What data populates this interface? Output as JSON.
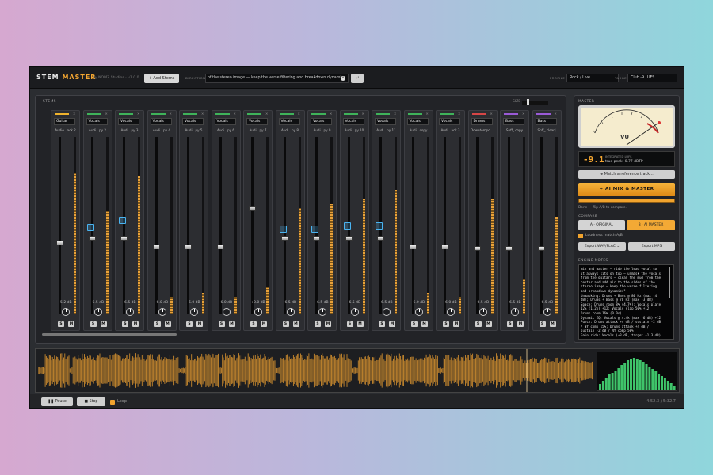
{
  "app": {
    "brand_a": "STEM",
    "brand_b": "MASTER",
    "subtitle": "by NOMZ Studios · v1.0.0",
    "add_stems": "+ Add Stems",
    "direction_label": "DIRECTION",
    "direction_value": "of the stereo image — keep the verse filtering and breakdown dynamics",
    "clear_icon": "close-icon",
    "submit_icon": "enter-icon",
    "profile_label": "PROFILE",
    "profile_value": "Rock / Live",
    "target_label": "TARGET",
    "target_value": "Club -9 LUFS"
  },
  "stems": {
    "title": "STEMS",
    "size_label": "SIZE",
    "strips": [
      {
        "name": "Guitar",
        "file": "Audio...ack 2",
        "color": "#f0b32d",
        "db": "-5.2 dB",
        "fader": 0.4,
        "meter": 0.8,
        "marker": null
      },
      {
        "name": "Vocals",
        "file": "Audi...py 2",
        "color": "#3fb35a",
        "db": "-6.5 dB",
        "fader": 0.43,
        "meter": 0.58,
        "marker": 0.49
      },
      {
        "name": "Vocals",
        "file": "Audi...py 3",
        "color": "#3fb35a",
        "db": "-6.5 dB",
        "fader": 0.43,
        "meter": 0.78,
        "marker": 0.53
      },
      {
        "name": "Vocals",
        "file": "Audi...py 4",
        "color": "#3fb35a",
        "db": "-6.0 dB",
        "fader": 0.38,
        "meter": 0.1,
        "marker": null
      },
      {
        "name": "Vocals",
        "file": "Audi...py 5",
        "color": "#3fb35a",
        "db": "-6.0 dB",
        "fader": 0.38,
        "meter": 0.12,
        "marker": null
      },
      {
        "name": "Vocals",
        "file": "Audi...py 6",
        "color": "#3fb35a",
        "db": "-6.0 dB",
        "fader": 0.38,
        "meter": 0.1,
        "marker": null
      },
      {
        "name": "Vocals",
        "file": "Audi...py 7",
        "color": "#3fb35a",
        "db": "+0.0 dB",
        "fader": 0.6,
        "meter": 0.15,
        "marker": null
      },
      {
        "name": "Vocals",
        "file": "Audi...py 8",
        "color": "#3fb35a",
        "db": "-6.5 dB",
        "fader": 0.43,
        "meter": 0.6,
        "marker": 0.48
      },
      {
        "name": "Vocals",
        "file": "Audi...py 9",
        "color": "#3fb35a",
        "db": "-6.5 dB",
        "fader": 0.43,
        "meter": 0.62,
        "marker": 0.48
      },
      {
        "name": "Vocals",
        "file": "Audi...py 10",
        "color": "#3fb35a",
        "db": "-6.5 dB",
        "fader": 0.43,
        "meter": 0.65,
        "marker": 0.5
      },
      {
        "name": "Vocals",
        "file": "Audi...py 11",
        "color": "#3fb35a",
        "db": "-6.5 dB",
        "fader": 0.43,
        "meter": 0.7,
        "marker": 0.5
      },
      {
        "name": "Vocals",
        "file": "Audi...copy",
        "color": "#3fb35a",
        "db": "-6.0 dB",
        "fader": 0.38,
        "meter": 0.12,
        "marker": null
      },
      {
        "name": "Vocals",
        "file": "Audi...ack 3",
        "color": "#3fb35a",
        "db": "-6.0 dB",
        "fader": 0.38,
        "meter": 0.1,
        "marker": null
      },
      {
        "name": "Drums",
        "file": "Downtempo ...",
        "color": "#d64646",
        "db": "-6.5 dB",
        "fader": 0.37,
        "meter": 0.65,
        "marker": null
      },
      {
        "name": "Bass",
        "file": "Snff_ copy",
        "color": "#9a5ad6",
        "db": "-6.5 dB",
        "fader": 0.37,
        "meter": 0.2,
        "marker": null
      },
      {
        "name": "Bass",
        "file": "Snff_ clear]",
        "color": "#9a5ad6",
        "db": "-6.5 dB",
        "fader": 0.37,
        "meter": 0.55,
        "marker": null
      }
    ]
  },
  "master": {
    "title": "MASTER",
    "vu_label": "VU",
    "lufs_value": "-9.1",
    "lufs_label": "INTEGRATED LUFS",
    "true_peak": "true peak -0.77 dBTP",
    "match_ref": "⊕  Match a reference track…",
    "ai_mix": "+  AI  MIX & MASTER",
    "progress": 1.0,
    "flip_hint": "Done — flip A/B to compare.",
    "compare_title": "COMPARE",
    "ab_a": "A · ORIGINAL",
    "ab_b": "B · AI MASTER",
    "loudness_match": "Loudness match A/B",
    "export_wav": "Export WAV/FLAC ⌄",
    "export_mp3": "Export MP3",
    "notes_title": "ENGINE NOTES",
    "notes": "mix and master — ride the lead vocal so\nit always sits on top — unmask the vocals\nfrom the guitars — clean the mud from the\ncenter and add air to the sides of the\nstereo image — keep the verse filtering\nand breakdown dynamics\"\nUnmasking: Drums + Bass @ 80 Hz (max -4\ndB); Drums + Bass @ 76 Hz (max -3 dB)\nSpace: Drums room 8% (4.7%); Vocals plate\n12% (1.2x) +12; Vocals slap 50% +12;\nDrums room 16% (0.0s)\nDynamic EQ: Vocals @ 4.4k (max -6 dB) +12\nPunch: Drums attack +4 dB / sustain -2 dB\n/ NY comp 15%; Drums attack +4 dB /\nsustain -2 dB / NY comp 50%\nGain ride: Vocals (±3 dB, target +1.3 dB)"
  },
  "transport": {
    "pause": "❚❚  Pause",
    "stop": "■  Stop",
    "loop": "Loop",
    "time": "4:52.3 / 5:32.7"
  },
  "colors": {
    "accent": "#f2a531",
    "wave": "#c9892e",
    "spectrum": "#3fc46a"
  }
}
